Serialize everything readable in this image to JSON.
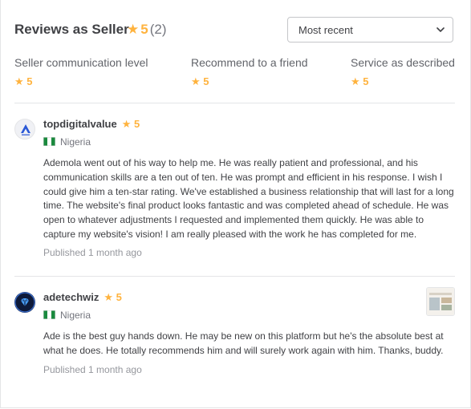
{
  "header": {
    "title": "Reviews as Seller",
    "rating": "5",
    "count": "(2)",
    "sort": {
      "selected": "Most recent"
    }
  },
  "categories": [
    {
      "label": "Seller communication level",
      "rating": "5"
    },
    {
      "label": "Recommend to a friend",
      "rating": "5"
    },
    {
      "label": "Service as described",
      "rating": "5"
    }
  ],
  "reviews": [
    {
      "username": "topdigitalvalue",
      "rating": "5",
      "country": "Nigeria",
      "text": "Ademola went out of his way to help me. He was really patient and professional, and his communication skills are a ten out of ten. He was prompt and efficient in his response. I wish I could give him a ten-star rating. We've established a business relationship that will last for a long time. The website's final product looks fantastic and was completed ahead of schedule. He was open to whatever adjustments I requested and implemented them quickly. He was able to capture my website's vision! I am really pleased with the work he has completed for me.",
      "published": "Published 1 month ago"
    },
    {
      "username": "adetechwiz",
      "rating": "5",
      "country": "Nigeria",
      "text": "Ade is the best guy hands down. He may be new on this platform but he's the absolute best at what he does. He totally recommends him and will surely work again with him. Thanks, buddy.",
      "published": "Published 1 month ago"
    }
  ],
  "colors": {
    "star": "#ffb33e",
    "text": "#404145",
    "muted": "#74767e"
  }
}
